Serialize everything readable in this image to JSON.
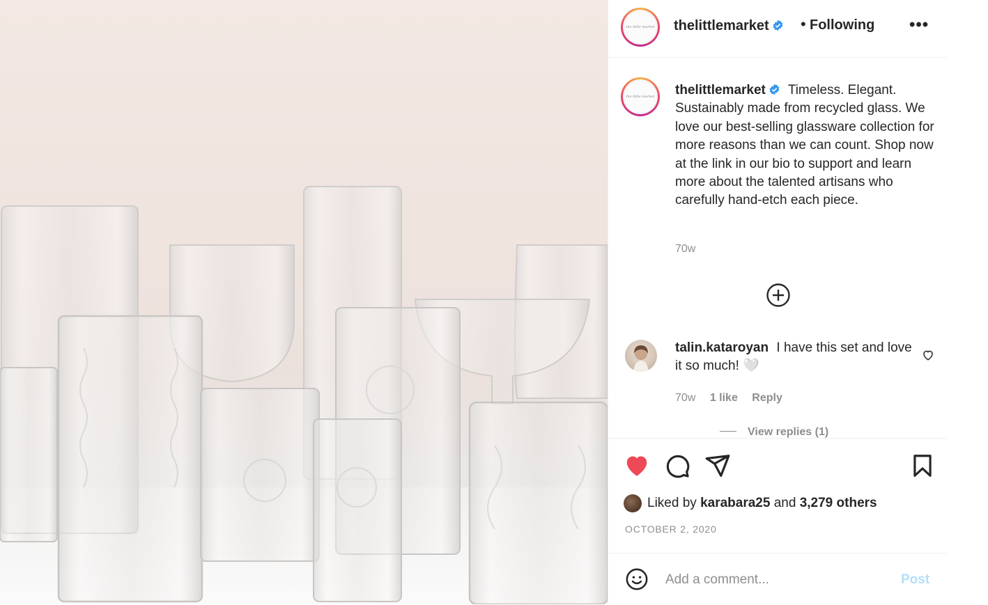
{
  "post": {
    "username": "thelittlemarket",
    "follow_state": "Following",
    "separator": "•",
    "more_label": "•••",
    "avatar_text": "the little market"
  },
  "caption": {
    "username": "thelittlemarket",
    "text": "Timeless. Elegant. Sustainably made from recycled glass. We love our best-selling glassware collection for more reasons than we can count. Shop now at the link in our bio to support and learn more about the talented artisans who carefully hand-etch each piece.",
    "age": "70w"
  },
  "comment": {
    "username": "talin.kataroyan",
    "text": "I have this set and love it so much! 🤍",
    "age": "70w",
    "likes": "1 like",
    "reply_label": "Reply",
    "view_replies": "View replies (1)"
  },
  "likes": {
    "prefix": "Liked by",
    "first_user": "karabara25",
    "joiner": "and",
    "others": "3,279 others"
  },
  "date": "OCTOBER 2, 2020",
  "comment_box": {
    "placeholder": "Add a comment...",
    "post_label": "Post"
  },
  "icons": {
    "like": "heart-filled-icon",
    "comment": "speech-bubble-icon",
    "share": "paper-plane-icon",
    "save": "bookmark-icon",
    "emoji": "smiley-icon",
    "load_more": "plus-circle-icon",
    "verified": "verified-badge-icon"
  },
  "colors": {
    "like_red": "#ed4956",
    "verified_blue": "#3897f0",
    "post_disabled": "#b2dffc",
    "muted": "#8e8e8e"
  }
}
